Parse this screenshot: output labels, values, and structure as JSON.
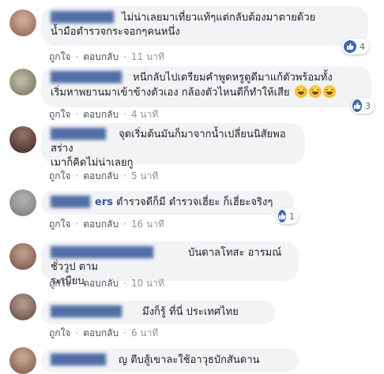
{
  "actions": {
    "like": "ถูกใจ",
    "reply": "ตอบกลับ",
    "dot": "·"
  },
  "comments": [
    {
      "text_line1": "ไม่น่าเลยมาเที่ยวแท้ๆแต่กลับต้องมาตายด้วย",
      "text_line2": "น้ำมือตำรวจกระจอกๆคนหนึ่ง",
      "time": "11 นาที",
      "reactions": "4"
    },
    {
      "text_line1": "หนีกลับไปเตรียมคำพูดหรูดูดีมาแก้ตัวพร้อมทั้ง",
      "text_line2": "เริ่มหาพยานมาเข้าข้างตัวเอง กล้องตัวไหนดีก็ทำให้เสีย",
      "time": "4 นาที",
      "reactions": "3",
      "emoji": [
        "laugh-emoji",
        "laugh-emoji",
        "laugh-emoji"
      ]
    },
    {
      "text_line1": "จุดเริ่มต้นมันก็มาจากน้ำเปลี่ยนนิสัยพอสร่าง",
      "text_line2": "เมาก็คิดไม่น่าเลยกู",
      "time": "5 นาที"
    },
    {
      "author_visible": "ers",
      "text_line1": "ตำรวจดีก็มี ตำรวจเฮี่ยะ ก็เฮี่ยะจริงๆ",
      "time": "16 นาที",
      "reactions": "1"
    },
    {
      "text_line1": "บันดาลโทสะ อารมณ์ชั่ววูป ตาม",
      "text_line2": "ระเบียบ",
      "time": "10 นาที"
    },
    {
      "text_line1": "มึงก็รู้ ที่นี่ ประเทศไทย",
      "time": "6 นาที"
    },
    {
      "text_line1": "ญ ตีบสู้เขาละใช้อาวุธบักสันดาน"
    }
  ],
  "colors": {
    "bubble": "#f2f3f5",
    "link": "#385898",
    "like_badge": "#4267b2"
  }
}
